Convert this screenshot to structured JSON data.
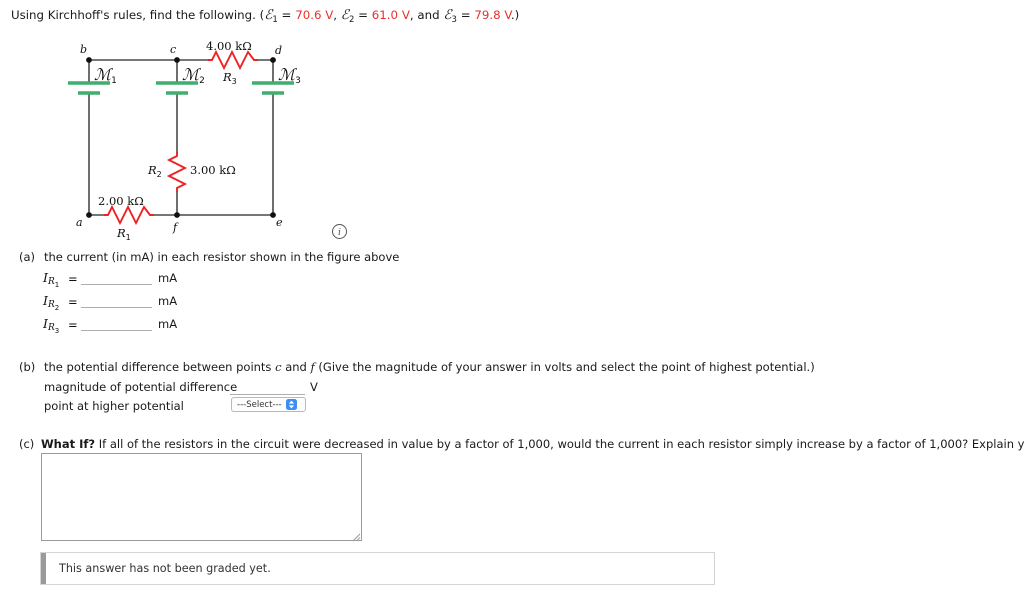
{
  "prompt": {
    "lead": "Using Kirchhoff's rules, find the following. (",
    "emf1_symbol": "ℰ",
    "emf1_sub": "1",
    "eq1": " = ",
    "emf1_value": "70.6 V",
    "sep1": ", ",
    "emf2_symbol": "ℰ",
    "emf2_sub": "2",
    "eq2": " = ",
    "emf2_value": "61.0 V",
    "sep2": ", and ",
    "emf3_symbol": "ℰ",
    "emf3_sub": "3",
    "eq3": " = ",
    "emf3_value": "79.8 V",
    "tail": ".)"
  },
  "figure": {
    "nodes": [
      "b",
      "c",
      "d",
      "a",
      "f",
      "e"
    ],
    "emf_labels": [
      {
        "symbol": "ℰ",
        "sub": "1"
      },
      {
        "symbol": "ℰ",
        "sub": "2"
      },
      {
        "symbol": "ℰ",
        "sub": "3"
      }
    ],
    "resistors": [
      {
        "name": "R",
        "sub": "1",
        "value": "2.00 kΩ"
      },
      {
        "name": "R",
        "sub": "2",
        "value": "3.00 kΩ"
      },
      {
        "name": "R",
        "sub": "3",
        "value": "4.00 kΩ"
      }
    ],
    "info_icon": "info-circle-icon",
    "colors": {
      "wire": "#4a4a4a",
      "resistor": "#ee2222",
      "battery": "#3fae6e",
      "node": "#111111"
    }
  },
  "parts": {
    "a": {
      "label": "(a)",
      "text": "the current (in mA) in each resistor shown in the figure above",
      "rows": [
        {
          "symbol": "I",
          "sub_main": "R",
          "sub_idx": "1",
          "equals": "=",
          "value": "",
          "unit": "mA"
        },
        {
          "symbol": "I",
          "sub_main": "R",
          "sub_idx": "2",
          "equals": "=",
          "value": "",
          "unit": "mA"
        },
        {
          "symbol": "I",
          "sub_main": "R",
          "sub_idx": "3",
          "equals": "=",
          "value": "",
          "unit": "mA"
        }
      ]
    },
    "b": {
      "label": "(b)",
      "text_pre": "the potential difference between points ",
      "point_1": "c",
      "text_mid": " and ",
      "point_2": "f",
      "text_post": " (Give the magnitude of your answer in volts and select the point of highest potential.)",
      "row1_label": "magnitude of potential difference",
      "row1_value": "",
      "row1_unit": "V",
      "row2_label": "point at higher potential",
      "select_value": "---Select---"
    },
    "c": {
      "label": "(c)",
      "whatif": "What If?",
      "text": " If all of the resistors in the circuit were decreased in value by a factor of 1,000, would the current in each resistor simply increase by a factor of 1,000? Explain your answer.",
      "answer_value": ""
    }
  },
  "notice": {
    "text": "This answer has not been graded yet."
  }
}
